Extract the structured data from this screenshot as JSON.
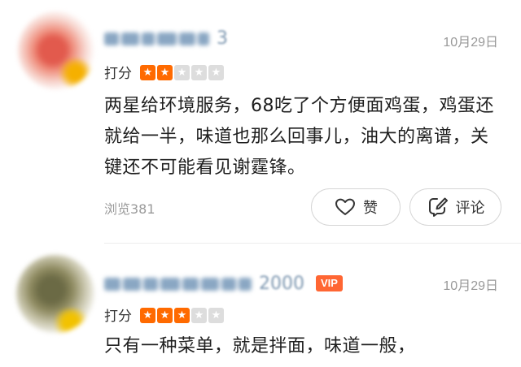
{
  "reviews": [
    {
      "username_visible_fragment": "3",
      "date": "10月29日",
      "rating_label": "打分",
      "rating_value": 2,
      "rating_max": 5,
      "content": "两星给环境服务，68吃了个方便面鸡蛋，鸡蛋还就给一半，味道也那么回事儿，油大的离谱，关键还不可能看见谢霆锋。",
      "views": "浏览381",
      "like_label": "赞",
      "comment_label": "评论"
    },
    {
      "username_visible_fragment": "2000",
      "vip_badge": "VIP",
      "date": "10月29日",
      "rating_label": "打分",
      "rating_value": 3,
      "rating_max": 5,
      "content": "只有一种菜单，就是拌面，味道一般，"
    }
  ],
  "colors": {
    "star_on": "#ff6a00",
    "star_off": "#dddddd",
    "vip_badge": "#ff6633",
    "secondary_text": "#999999"
  },
  "icons": {
    "like": "heart-icon",
    "comment": "edit-comment-icon",
    "star": "star-icon"
  }
}
